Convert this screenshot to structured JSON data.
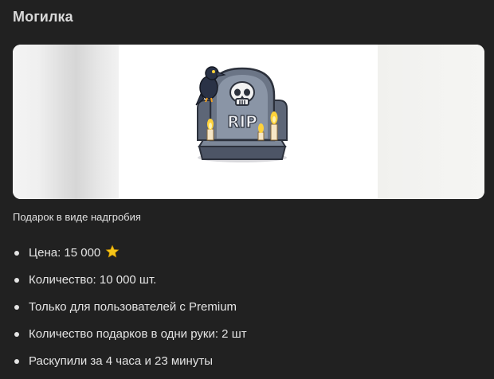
{
  "title": "Могилка",
  "banner": {
    "image": "tombstone-rip-gift",
    "image_text": "RIP",
    "colors": {
      "stone": "#6f7a8a",
      "stone_dark": "#3d4452",
      "candle_flame": "#ffd23a",
      "crow": "#2a3246"
    }
  },
  "caption": "Подарок в виде надгробия",
  "facts": {
    "price_label": "Цена: 15 000",
    "price_icon": "star-icon",
    "quantity": "Количество: 10 000 шт.",
    "premium_only": "Только для пользователей с Premium",
    "per_user": "Количество подарков в одни руки: 2 шт",
    "sold_out": "Раскупили за 4 часа и 23 минуты"
  },
  "accent": "#f5c518"
}
